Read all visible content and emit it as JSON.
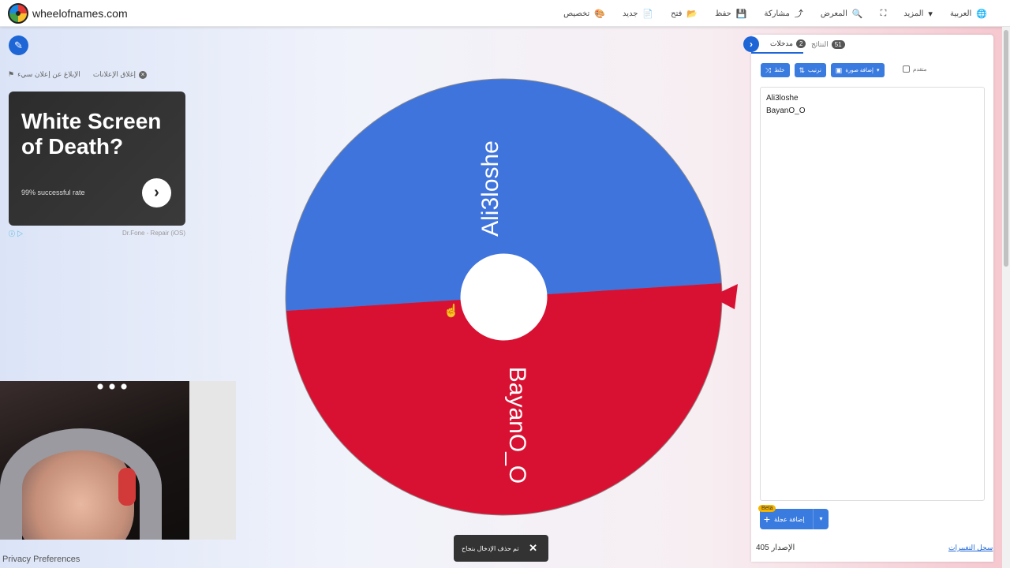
{
  "header": {
    "site_name": "wheelofnames.com",
    "nav": [
      {
        "label": "العربية",
        "icon": "globe-icon",
        "glyph": "🌐"
      },
      {
        "label": "المزيد",
        "icon": "caret-down-icon",
        "glyph": "▾"
      },
      {
        "label": "",
        "icon": "fullscreen-icon",
        "glyph": "⛶"
      },
      {
        "label": "المعرض",
        "icon": "search-icon",
        "glyph": "🔍"
      },
      {
        "label": "مشاركة",
        "icon": "share-icon",
        "glyph": "⤴"
      },
      {
        "label": "حفظ",
        "icon": "save-icon",
        "glyph": "💾"
      },
      {
        "label": "فتح",
        "icon": "folder-icon",
        "glyph": "📂"
      },
      {
        "label": "جديد",
        "icon": "file-icon",
        "glyph": "📄"
      },
      {
        "label": "تخصيص",
        "icon": "palette-icon",
        "glyph": "🎨"
      }
    ]
  },
  "left": {
    "report_ad": "الإبلاغ عن إعلان سيء",
    "close_ads": "إغلاق الإعلانات",
    "ad": {
      "title": "White Screen of Death?",
      "subtitle": "99% successful rate",
      "brand": "Dr.Fone - Repair (iOS)"
    },
    "privacy": "Privacy Preferences"
  },
  "wheel": {
    "segments": [
      {
        "label": "Ali3loshe",
        "color": "#3f74dd"
      },
      {
        "label": "BayanO_O",
        "color": "#d81132"
      }
    ],
    "pointer_color": "#d81132"
  },
  "toast": {
    "message": "تم حذف الإدخال بنجاح",
    "close": "✕"
  },
  "panel": {
    "tab_entries": "مدخلات",
    "entries_count": "2",
    "tab_results": "النتائج",
    "results_count": "51",
    "shuffle": "خلط",
    "sort": "ترتيب",
    "add_image": "إضافة صورة",
    "advanced": "متقدم",
    "entries": [
      "Ali3loshe",
      "BayanO_O"
    ],
    "add_wheel": "إضافة عجلة",
    "beta": "Beta",
    "version_label": "الإصدار",
    "version": "405",
    "changelog": "سجل التغييرات"
  }
}
